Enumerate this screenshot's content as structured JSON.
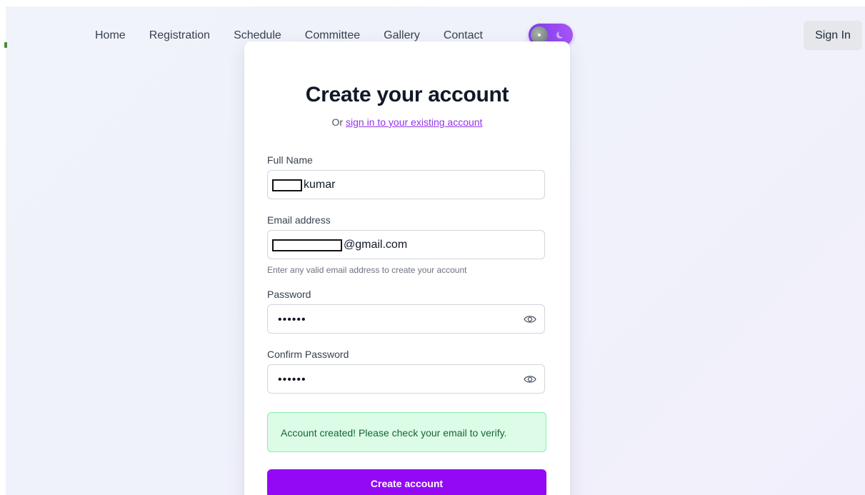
{
  "nav": {
    "items": [
      {
        "label": "Home"
      },
      {
        "label": "Registration"
      },
      {
        "label": "Schedule"
      },
      {
        "label": "Committee"
      },
      {
        "label": "Gallery"
      },
      {
        "label": "Contact"
      }
    ],
    "theme_toggle_icon": "moon-icon",
    "sign_in_label": "Sign In"
  },
  "form": {
    "title": "Create your account",
    "subtitle_prefix": "Or",
    "signin_link": "sign in to your existing account",
    "full_name": {
      "label": "Full Name",
      "visible_value": "kumar"
    },
    "email": {
      "label": "Email address",
      "visible_value": "@gmail.com",
      "hint": "Enter any valid email address to create your account"
    },
    "password": {
      "label": "Password",
      "masked_value": "••••••",
      "toggle_icon": "eye-icon"
    },
    "confirm_password": {
      "label": "Confirm Password",
      "masked_value": "••••••",
      "toggle_icon": "eye-icon"
    },
    "success_message": "Account created! Please check your email to verify.",
    "submit_label": "Create account"
  },
  "colors": {
    "accent": "#9308f5",
    "link": "#9333ea",
    "success_bg": "#dcfce7",
    "success_border": "#86efac",
    "success_text": "#166534",
    "toggle_start": "#7c3aed",
    "toggle_end": "#a855f7"
  }
}
